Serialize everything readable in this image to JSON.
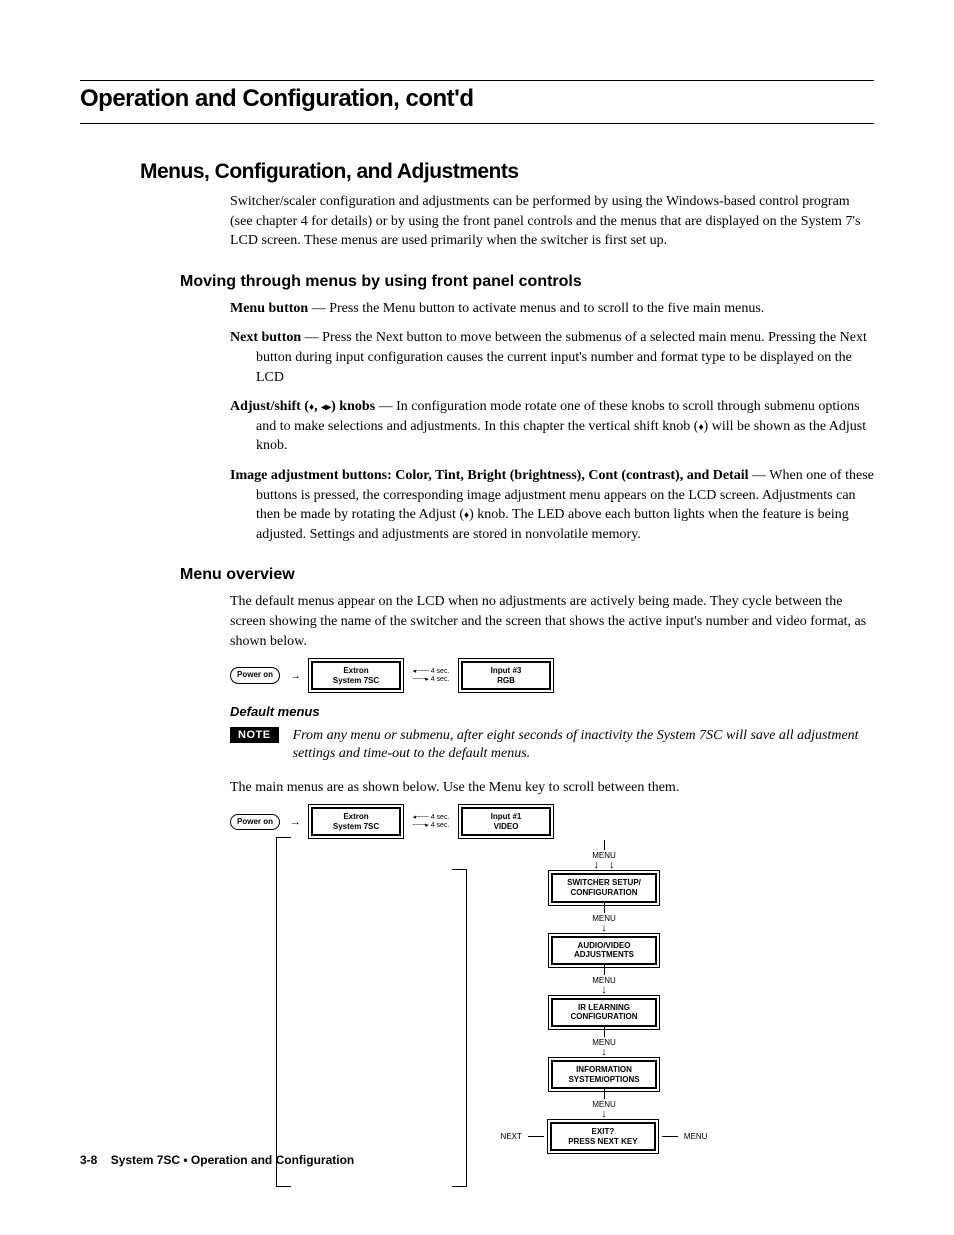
{
  "header_title": "Operation and Configuration, cont'd",
  "h2_menus": "Menus, Configuration, and Adjustments",
  "intro_para": "Switcher/scaler configuration and adjustments can be performed by using the Windows-based control program (see chapter 4 for details) or by using the front panel controls and the menus that are displayed on the System 7's LCD screen. These menus are used primarily when the switcher is first set up.",
  "h3_moving": "Moving through menus by using front panel controls",
  "terms": {
    "menu_b": "Menu button",
    "menu_t": " —  Press the Menu button to activate menus and to scroll to the five main menus.",
    "next_b": "Next button",
    "next_t": " —  Press the Next button to move between the submenus of a selected main menu.  Pressing the Next button during input configuration causes the current input's number and format type to be displayed on the LCD",
    "adj_b_pre": "Adjust/shift (",
    "adj_b_mid": ", ",
    "adj_b_post": ") knobs",
    "adj_t": " —  In configuration mode rotate one of these knobs to scroll through submenu options and to make selections and adjustments.  In this chapter the vertical shift knob (",
    "adj_t2": ") will be shown as the Adjust knob.",
    "img_b": "Image adjustment buttons: Color, Tint, Bright (brightness), Cont (contrast), and Detail",
    "img_t": " —  When one of these buttons is pressed, the corresponding image adjustment menu appears on the LCD screen.  Adjustments can then be made by rotating the Adjust (",
    "img_t2": ") knob.  The LED above each button lights when the feature is being adjusted.  Settings and adjustments are stored in nonvolatile memory."
  },
  "h3_overview": "Menu overview",
  "overview_para": "The default menus appear on the LCD when no adjustments are actively being made.  They cycle between the screen showing the name of the switcher and the screen that shows the active input's number and video format, as shown below.",
  "lcd1": {
    "pill": "Power\non",
    "box1": "Extron\nSystem 7SC",
    "dash_top": "4 sec.",
    "dash_bot": "4 sec.",
    "box2": "Input #3\nRGB"
  },
  "h4_default": "Default menus",
  "note_label": "NOTE",
  "note_text": "From any menu or submenu, after eight seconds of inactivity the System 7SC will save all adjustment settings and time-out to the default menus.",
  "main_para": "The main menus are as shown below.  Use the Menu key to scroll between them.",
  "flow": {
    "pill": "Power\non",
    "box1": "Extron\nSystem 7SC",
    "dash_top": "4 sec.",
    "dash_bot": "4 sec.",
    "box2": "Input #1\nVIDEO",
    "menu_label": "MENU",
    "m1": "SWITCHER SETUP/\nCONFIGURATION",
    "m2": "AUDIO/VIDEO\nADJUSTMENTS",
    "m3": "IR LEARNING\nCONFIGURATION",
    "m4": "INFORMATION\nSYSTEM/OPTIONS",
    "exit": "EXIT?\nPRESS NEXT KEY",
    "next_lbl": "NEXT",
    "menu_lbl": "MENU"
  },
  "footer_page": "3-8",
  "footer_text": "System 7SC • Operation and Configuration"
}
